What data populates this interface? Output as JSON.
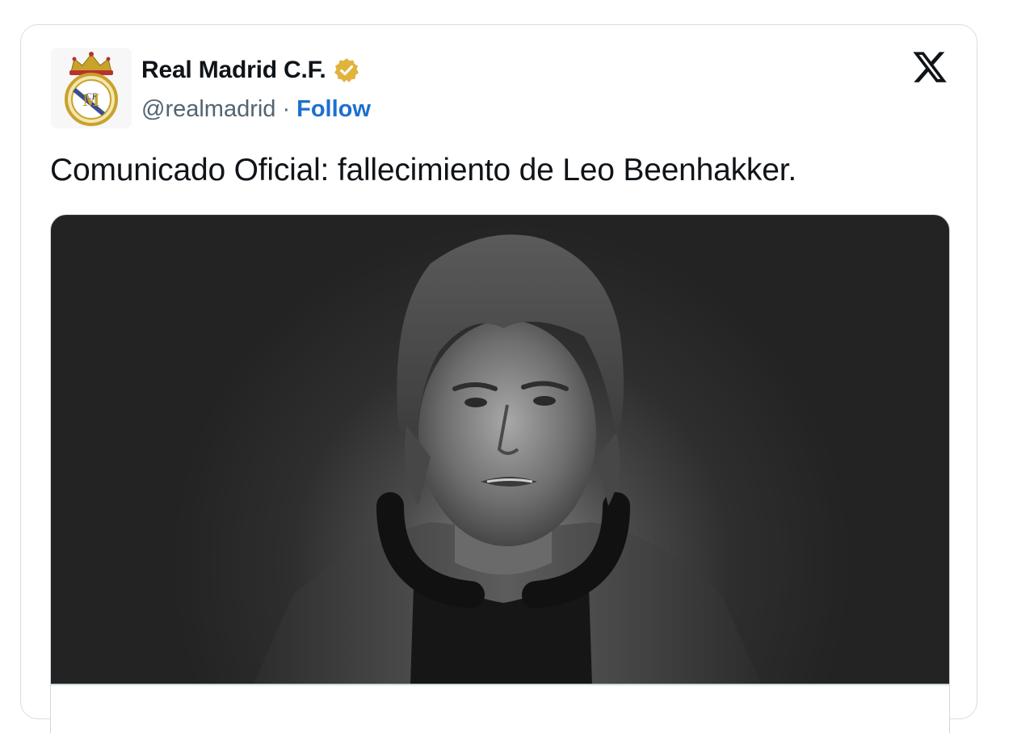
{
  "tweet": {
    "author": {
      "display_name": "Real Madrid C.F.",
      "handle": "@realmadrid",
      "separator": "·",
      "follow_label": "Follow",
      "verified": true,
      "verified_color": "#e2b33b"
    },
    "text": "Comunicado Oficial: fallecimiento de Leo Beenhakker.",
    "media": {
      "type": "photo",
      "style": "black-and-white portrait"
    }
  },
  "icons": {
    "avatar": "real-madrid-crest-icon",
    "verified": "verified-badge-icon",
    "platform": "x-logo-icon"
  },
  "colors": {
    "text_primary": "#0f1419",
    "text_secondary": "#536471",
    "link": "#1d6fcf",
    "border": "#d9dde1"
  }
}
